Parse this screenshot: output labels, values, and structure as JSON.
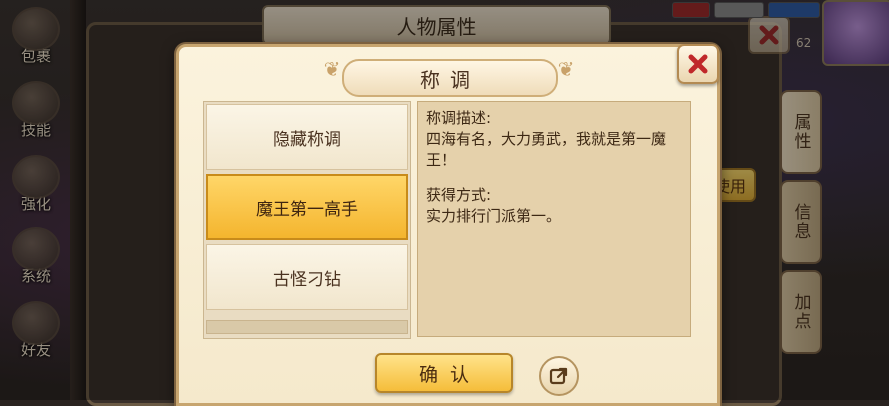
{
  "background": {
    "panel_title": "人物属性",
    "left_menu": [
      "包裹",
      "技能",
      "强化",
      "系统",
      "好友"
    ],
    "right_tabs": [
      "属性",
      "信息",
      "加点"
    ],
    "level": "62",
    "side_button_label": "使用"
  },
  "dialog": {
    "title": "称调",
    "title_list": [
      {
        "label": "隐藏称调",
        "selected": false
      },
      {
        "label": "魔王第一高手",
        "selected": true
      },
      {
        "label": "古怪刁钻",
        "selected": false
      }
    ],
    "description_heading": "称调描述:",
    "description_text": "四海有名，大力勇武，我就是第一魔王！",
    "obtain_heading": "获得方式:",
    "obtain_text": "实力排行门派第一。",
    "confirm_label": "确认"
  },
  "icons": {
    "close": "close-icon",
    "share": "share-icon"
  },
  "colors": {
    "selected_item": "#f4b52e",
    "close_x": "#c0282a",
    "dialog_bg": "#f5e9cc"
  }
}
